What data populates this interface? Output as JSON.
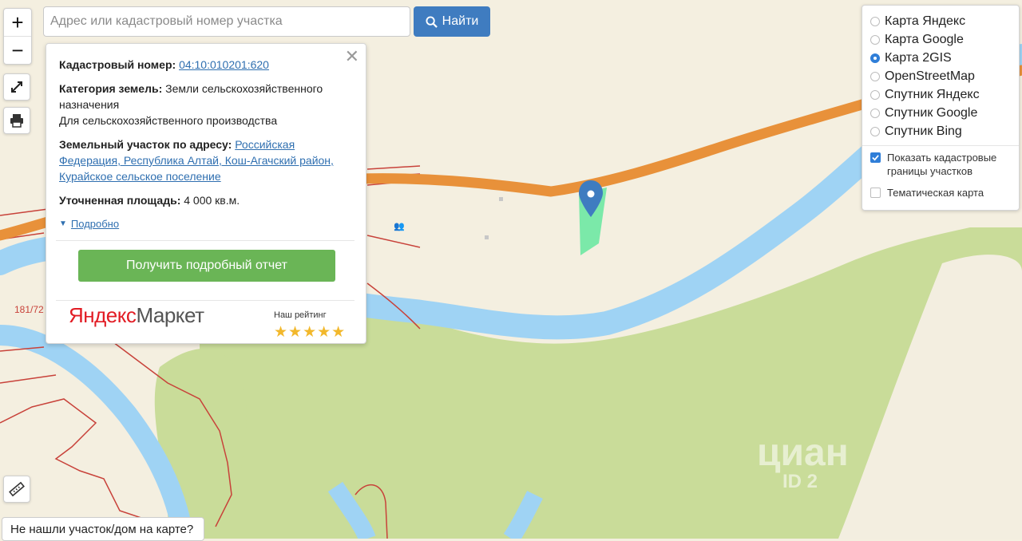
{
  "search": {
    "placeholder": "Адрес или кадастровый номер участка",
    "value": ""
  },
  "find_button": {
    "label": "Найти",
    "icon": "search-icon"
  },
  "zoom": {
    "in": "+",
    "out": "−"
  },
  "controls": {
    "fullscreen_icon": "expand-icon",
    "print_icon": "printer-icon",
    "ruler_icon": "ruler-icon"
  },
  "popup": {
    "cadastral_label": "Кадастровый номер:",
    "cadastral_number": "04:10:010201:620",
    "category_label": "Категория земель:",
    "category_value": "Земли сельскохозяйственного назначения",
    "usage": "Для сельскохозяйственного производства",
    "address_label": "Земельный участок по адресу:",
    "address_value": "Российская Федерация, Республика Алтай, Кош-Агачский район, Курайское сельское поселение",
    "area_label": "Уточненная площадь:",
    "area_value": "4 000 кв.м.",
    "more_link": "Подробно",
    "report_button": "Получить подробный отчет",
    "brand_part1": "Яндекс",
    "brand_part2": "Маркет",
    "rating_label": "Наш рейтинг",
    "rating_stars": "★★★★★",
    "rating_value": 5
  },
  "layers": {
    "options": [
      {
        "label": "Карта Яндекс",
        "selected": false
      },
      {
        "label": "Карта Google",
        "selected": false
      },
      {
        "label": "Карта 2GIS",
        "selected": true
      },
      {
        "label": "OpenStreetMap",
        "selected": false
      },
      {
        "label": "Спутник Яндекс",
        "selected": false
      },
      {
        "label": "Спутник Google",
        "selected": false
      },
      {
        "label": "Спутник Bing",
        "selected": false
      }
    ],
    "show_boundaries": {
      "label": "Показать кадастровые границы участков",
      "checked": true
    },
    "thematic": {
      "label": "Тематическая карта",
      "checked": false
    }
  },
  "map": {
    "road_label": "181/72",
    "road_color": "#e8913a",
    "river_color": "#9fd3f4",
    "field_color": "#c9dc99",
    "parcel_color": "#6ee8a3",
    "boundary_color": "#c8423a"
  },
  "watermark": {
    "brand": "циан",
    "id_text": "ID 2"
  },
  "not_found": "Не нашли участок/дом на карте?"
}
